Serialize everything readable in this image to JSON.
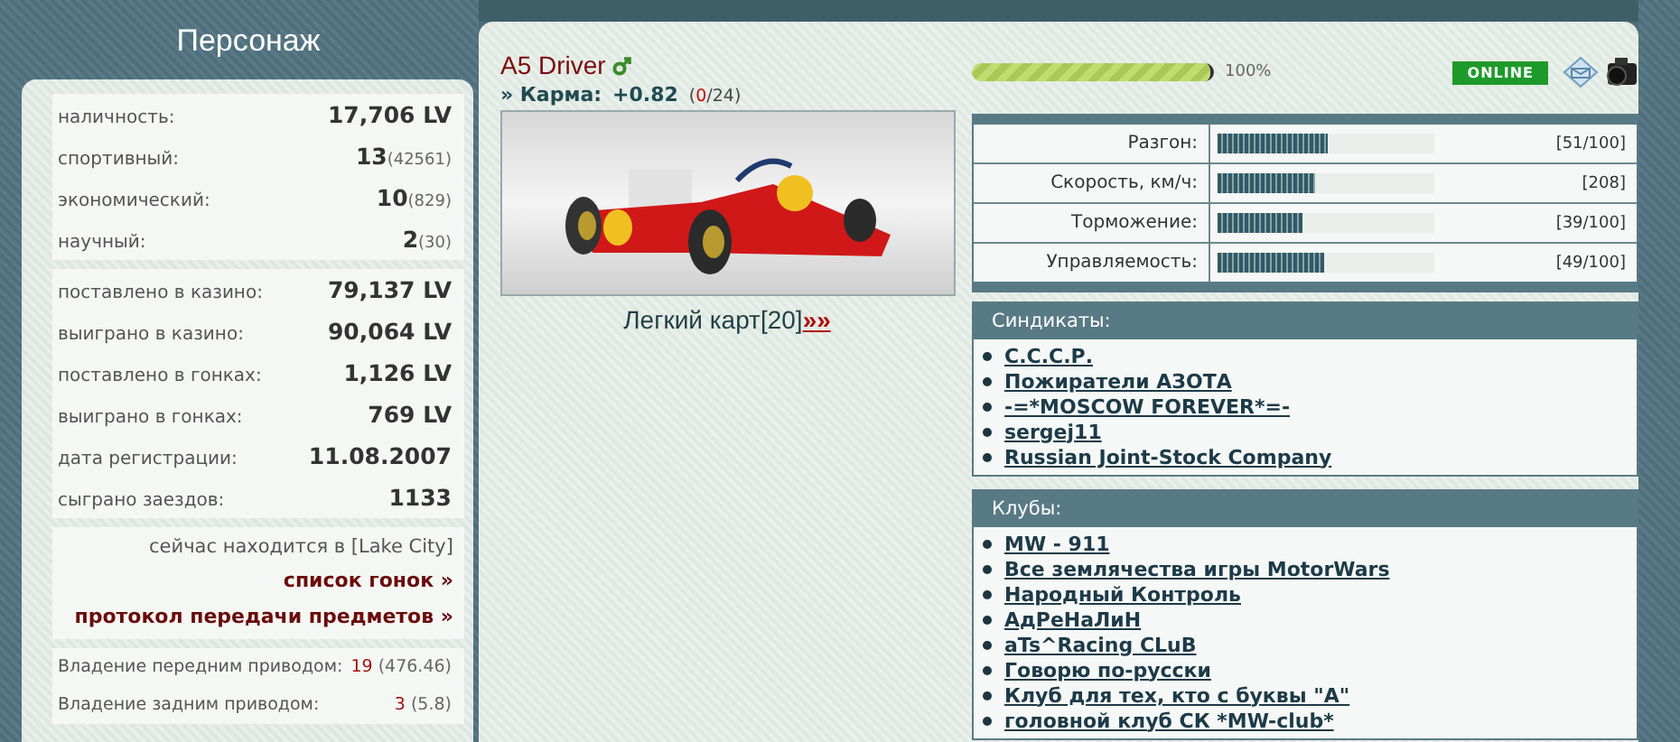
{
  "sidebar": {
    "title": "Персонаж",
    "sections": [
      {
        "kind": "stats",
        "rows": [
          {
            "label": "наличность:",
            "value": "17,706 LV"
          },
          {
            "label": "спортивный:",
            "value": "13",
            "extra": "(42561)"
          },
          {
            "label": "экономический:",
            "value": "10",
            "extra": "(829)"
          },
          {
            "label": "научный:",
            "value": "2",
            "extra": "(30)"
          }
        ]
      },
      {
        "kind": "stats",
        "rows": [
          {
            "label": "поставлено в казино:",
            "value": "79,137 LV"
          },
          {
            "label": "выиграно в казино:",
            "value": "90,064 LV"
          },
          {
            "label": "поставлено в гонках:",
            "value": "1,126 LV"
          },
          {
            "label": "выиграно в гонках:",
            "value": "769 LV"
          },
          {
            "label": "дата регистрации:",
            "value": "11.08.2007"
          },
          {
            "label": "сыграно заездов:",
            "value": "1133"
          }
        ]
      },
      {
        "kind": "location",
        "text": "сейчас находится в [Lake City]",
        "links": [
          "список гонок »",
          "протокол передачи предметов »"
        ]
      },
      {
        "kind": "skills",
        "rows": [
          {
            "label": "Владение передним приводом:",
            "value": "19",
            "extra": "(476.46)"
          },
          {
            "label": "Владение задним приводом:",
            "value": "3",
            "extra": "(5.8)"
          }
        ]
      }
    ]
  },
  "profile": {
    "name": "A5 Driver",
    "karma": {
      "label": "» Карма:",
      "value": "+0.82",
      "votes": [
        {
          "text": "(",
          "kind": "plain"
        },
        {
          "text": "0",
          "kind": "negative"
        },
        {
          "text": "/24)",
          "kind": "plain"
        }
      ]
    },
    "car": {
      "kind": "picture",
      "caption": "Легкий карт[20]",
      "link": "»»"
    }
  },
  "experience": {
    "level": 1.0,
    "reading": "100%"
  },
  "status": {
    "online": true,
    "label": "ONLINE"
  },
  "car_stats": [
    {
      "label": "Разгон:",
      "level": 0.51,
      "reading": "[51/100]"
    },
    {
      "label": "Скорость, км/ч:",
      "level": 0.45,
      "reading": "[208]"
    },
    {
      "label": "Торможение:",
      "level": 0.39,
      "reading": "[39/100]"
    },
    {
      "label": "Управляемость:",
      "level": 0.49,
      "reading": "[49/100]"
    }
  ],
  "syndicates": {
    "title": "Синдикаты:",
    "items": [
      "С.С.С.Р.",
      "Пожиратели АЗОТА",
      "-=*MOSCOW FOREVER*=-",
      "sergej11",
      "Russian Joint-Stock Company"
    ]
  },
  "clubs": {
    "title": "Клубы:",
    "items": [
      "MW - 911",
      "Все землячества игры MotorWars",
      "Народный Контроль",
      "АдРеНаЛиН",
      "aTs^Racing CLuB",
      "Говорю по-русски",
      "Клуб для тех, кто с буквы \"А\"",
      "головной клуб СК *MW-club*"
    ]
  }
}
